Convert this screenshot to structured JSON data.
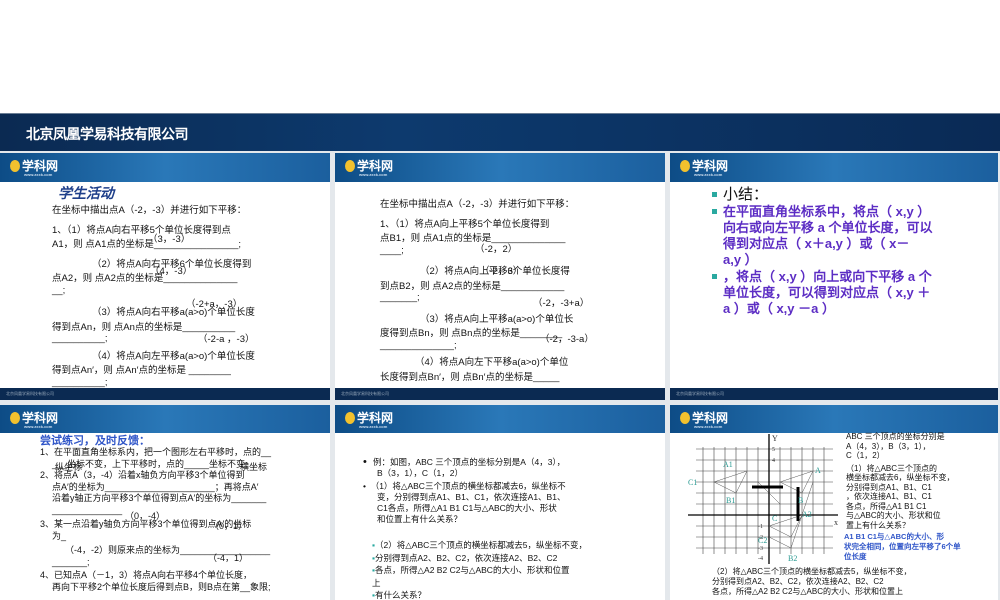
{
  "banner": {
    "company": "北京凤凰学易科技有限公司"
  },
  "slide_common": {
    "logo": "学科网",
    "logo_url_text": "www.zxxk.com",
    "footer": "北京凤凰学易科技有限公司"
  },
  "slide1": {
    "title": "学生活动",
    "lines": [
      "在坐标中描出点A（-2，-3）并进行如下平移：",
      "1、（1）将点A向右平移5个单位长度得到点",
      "A1，则 点A1点的坐标是________________;",
      "（2）将点A向右平移6个单位长度得到",
      "点A2，则 点A2点的坐标是______________",
      "__;",
      "（3）将点A向右平移a(a>o)个单位长度",
      "得到点An，则 点An点的坐标是__________",
      "__________;",
      "（4）将点A向左平移a(a>o)个单位长度",
      "得到点An′，则 点An′点的坐标是 ________",
      "__________;"
    ],
    "answers": [
      "（3，-3）",
      "（4，-3）",
      "（-2+a，-3）",
      "（-2-a ，-3）"
    ]
  },
  "slide2": {
    "lines": [
      "在坐标中描出点A（-2，-3）并进行如下平移：",
      "1、（1）将点A向上平移5个单位长度得到",
      "点B1，则 点A1点的坐标是______________",
      "____;",
      "（2）将点A向上平移6个单位长度得",
      "到点B2，则 点A2点的坐标是____________",
      "_______;",
      "（3）将点A向上平移a(a>o)个单位长",
      "度得到点Bn，则 点Bn点的坐标是________",
      "______________;",
      "（4）将点A向左下平移a(a>o)个单位",
      "长度得到点Bn′，则 点Bn′点的坐标是_____",
      "________________ ._"
    ],
    "answers": [
      "（-2，2）",
      "（-2，3）",
      "（-2，-3+a）",
      "（-2，-3-a）"
    ]
  },
  "slide3": {
    "heading": "小结：",
    "bullet2": [
      "在平面直角坐标系中，将点（ x,y ）",
      "向右或向左平移 a 个单位长度，可以",
      "得到对应点（  x＋a,y ）或（  x－",
      "a,y  ）"
    ],
    "bullet3": [
      "，将点（ x,y ）向上或向下平移 a 个",
      "单位长度，可以得到对应点（  x,y ＋",
      "a ）或（  x,y －a  ）"
    ]
  },
  "slide4": {
    "title": "尝试练习，及时反馈：",
    "lines": [
      "1、在平面直角坐标系内，把一个图形左右平移时，点的__",
      "___坐标不变，上下平移时，点的_____坐标不变;",
      "2、将点A（3，-4）沿着x轴负方向平移3个单位得到",
      "点A′的坐标为______________________；再将点A′",
      "沿着y轴正方向平移3个单位得到点A′的坐标为_______",
      "______________",
      "3、某一点沿着y轴负方向平移3个单位得到点A′的坐标",
      "为_",
      "（-4，-2）则原来点的坐标为__________________",
      "_______;",
      "4、已知点A（－1，3）将点A向右平移4个单位长度，",
      "再向下平移2个单位长度后得到点B，则B点在第__象限;"
    ],
    "answers": [
      "纵坐标",
      "横坐标",
      "（0，-4）",
      "（0，1）",
      "（-4，1）"
    ]
  },
  "slide5": {
    "lines1": [
      "例：如图，ABC 三个顶点的坐标分别是A（4，3），",
      "B（3，1），C（1，2）"
    ],
    "lines2": [
      "（1）将△ABC三个顶点的横坐标都减去6，纵坐标不",
      "变，分别得到点A1、B1、C1，依次连接A1、B1、",
      "C1各点，所得△A1 B1 C1与△ABC的大小、形状",
      "和位置上有什么关系？"
    ],
    "lines3": [
      "（2）将△ABC三个顶点的横坐标都减去5，纵坐标不变，",
      "分别得到点A2、B2、C2，依次连接A2、B2、C2",
      "各点，所得△A2 B2 C2与△ABC的大小、形状和位置",
      "上",
      "有什么关系？"
    ]
  },
  "slide6": {
    "right": [
      "ABC 三个顶点的坐标分别是",
      "A（4，3），B（3，1），",
      "C（1，2）"
    ],
    "q1": [
      "（1）将△ABC三个顶点的",
      "横坐标都减去6，纵坐标不变，",
      "分别得到点A1、B1、C1",
      "，依次连接A1、B1、C1",
      "各点，所得△A1 B1 C1",
      "与△ABC的大小、形状和位",
      "置上有什么关系？"
    ],
    "answer": [
      "A1 B1 C1与△ABC的大小、形",
      "状完全相同，位置向左平移了6个单",
      "位长度"
    ],
    "bottom": [
      "（2）将△ABC三个顶点的横坐标都减去5，纵坐标不变，",
      "分别得到点A2、B2、C2，依次连接A2、B2、C2",
      "各点，所得△A2 B2 C2与△ABC的大小、形状和位置上"
    ],
    "axis": {
      "y": "Y",
      "x": "x",
      "ticks": [
        "5",
        "4",
        "-1",
        "-2",
        "-3",
        "-4"
      ],
      "labels": [
        "A1",
        "C1",
        "B1",
        "A",
        "B",
        "C",
        "A2",
        "B2",
        "C2"
      ]
    }
  },
  "colors": {
    "banner": "#0b2a52",
    "header": "#2a78b8",
    "purple": "#5c2dc4",
    "blue_title": "#2f55c8",
    "teal": "#2aa9a0"
  }
}
